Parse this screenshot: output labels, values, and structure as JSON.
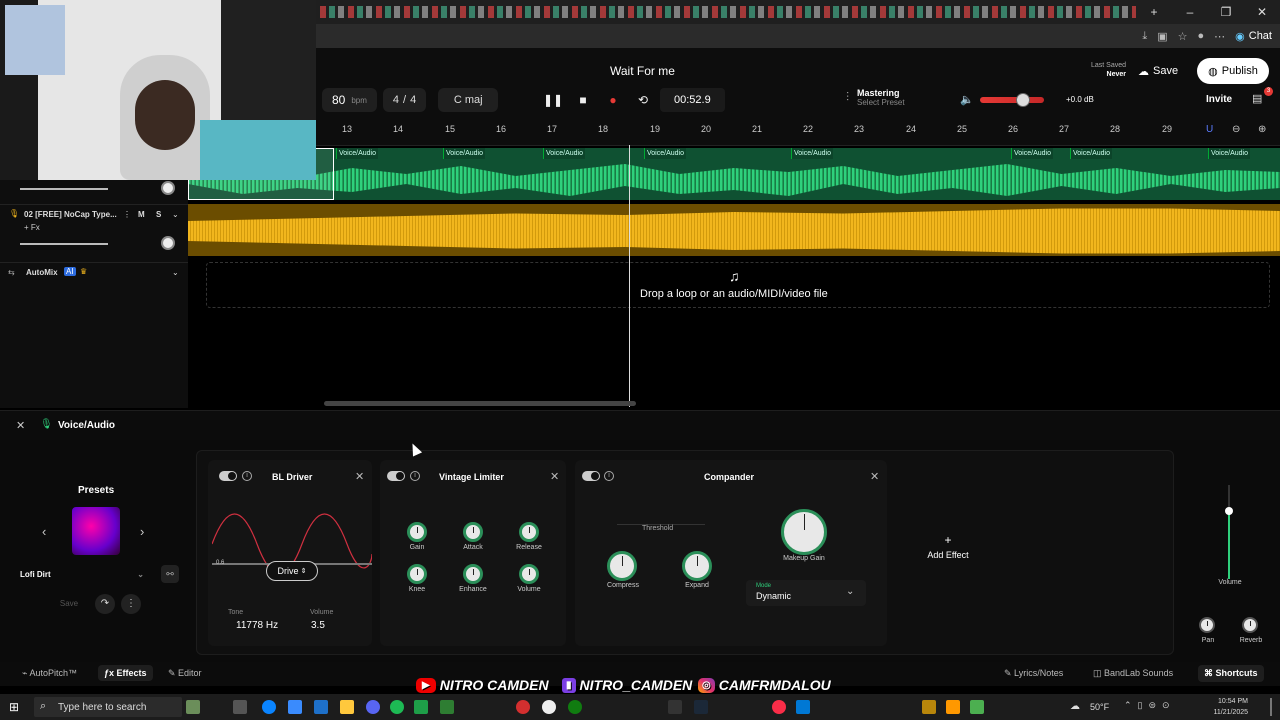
{
  "browser": {
    "chat_label": "Chat"
  },
  "header": {
    "song_title": "Wait For me",
    "bpm_value": "80",
    "bpm_unit": "bpm",
    "time_sig_num": "4",
    "time_sig_sep": "/",
    "time_sig_den": "4",
    "key": "C maj",
    "time": "00:52.9",
    "mastering_label": "Mastering",
    "mastering_preset": "Select Preset",
    "volume_db": "+0.0 dB",
    "last_saved_label": "Last Saved",
    "last_saved_value": "Never",
    "save_label": "Save",
    "publish_label": "Publish",
    "invite_label": "Invite",
    "notif_count": "3"
  },
  "ruler": {
    "ticks": [
      "13",
      "14",
      "15",
      "16",
      "17",
      "18",
      "19",
      "20",
      "21",
      "22",
      "23",
      "24",
      "25",
      "26",
      "27",
      "28",
      "29"
    ]
  },
  "tracks": [
    {
      "name": "",
      "clip_label": "Voice/Audio"
    },
    {
      "name": "02 [FREE] NoCap Type...",
      "mute": "M",
      "solo": "S",
      "fx": "+ Fx"
    },
    {
      "name": "AutoMix",
      "ai_badge": "AI"
    }
  ],
  "drop": {
    "text": "Drop a loop or an audio/MIDI/video file"
  },
  "fx": {
    "track_title": "Voice/Audio",
    "presets_label": "Presets",
    "preset_name": "Lofi Dirt",
    "save_label": "Save",
    "effects": [
      {
        "name": "BL Driver",
        "drive_label": "Drive",
        "graph_value": "0.6",
        "tone_label": "Tone",
        "tone_value": "11778 Hz",
        "volume_label": "Volume",
        "volume_value": "3.5"
      },
      {
        "name": "Vintage Limiter",
        "knobs": [
          "Gain",
          "Attack",
          "Release",
          "Knee",
          "Enhance",
          "Volume"
        ]
      },
      {
        "name": "Compander",
        "threshold_label": "Threshold",
        "compress_label": "Compress",
        "expand_label": "Expand",
        "makeup_label": "Makeup Gain",
        "mode_label": "Mode",
        "mode_value": "Dynamic"
      }
    ],
    "add_effect_label": "Add Effect",
    "volume_label": "Volume",
    "pan_label": "Pan",
    "reverb_label": "Reverb"
  },
  "bottom_tabs": {
    "autopitch": "AutoPitch™",
    "effects": "Effects",
    "editor": "Editor",
    "lyrics": "Lyrics/Notes",
    "sounds": "BandLab Sounds",
    "shortcuts": "Shortcuts"
  },
  "socials": [
    "NITRO CAMDEN",
    "NITRO_CAMDEN",
    "CAMFRMDALOU"
  ],
  "taskbar": {
    "search_placeholder": "Type here to search",
    "weather": "50°F",
    "time": "10:54 PM",
    "date": "11/21/2025"
  },
  "colors": {
    "accent_green": "#2fd07c",
    "track_yellow": "#f2b61d",
    "record_red": "#e53935"
  }
}
